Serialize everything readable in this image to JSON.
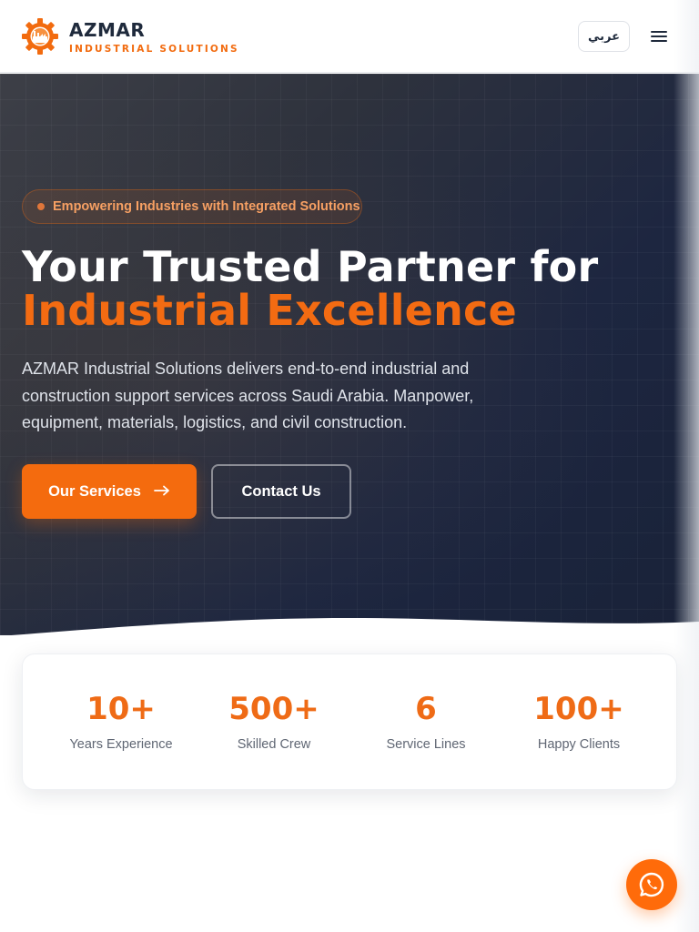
{
  "header": {
    "brand_name": "AZMAR",
    "brand_sub": "INDUSTRIAL SOLUTIONS",
    "lang_label": "عربي",
    "menu_icon": "hamburger-menu-icon",
    "logo_icon": "gear-factory-logo"
  },
  "hero": {
    "tagline": "Empowering Industries with Integrated Solutions",
    "title_line1": "Your Trusted Partner for",
    "title_line2": "Industrial Excellence",
    "lead": "AZMAR Industrial Solutions delivers end-to-end industrial and construction support services across Saudi Arabia. Manpower, equipment, materials, logistics, and civil construction.",
    "primary_cta": "Our Services",
    "primary_cta_icon": "arrow-right-icon",
    "secondary_cta": "Contact Us"
  },
  "stats": [
    {
      "value": "10+",
      "label": "Years Experience"
    },
    {
      "value": "500+",
      "label": "Skilled Crew"
    },
    {
      "value": "6",
      "label": "Service Lines"
    },
    {
      "value": "100+",
      "label": "Happy Clients"
    }
  ],
  "floating": {
    "whatsapp_icon": "whatsapp-icon"
  },
  "colors": {
    "accent": "#f46b0e",
    "dark": "#1f2a3c",
    "hero_bg": "#1d2640"
  }
}
